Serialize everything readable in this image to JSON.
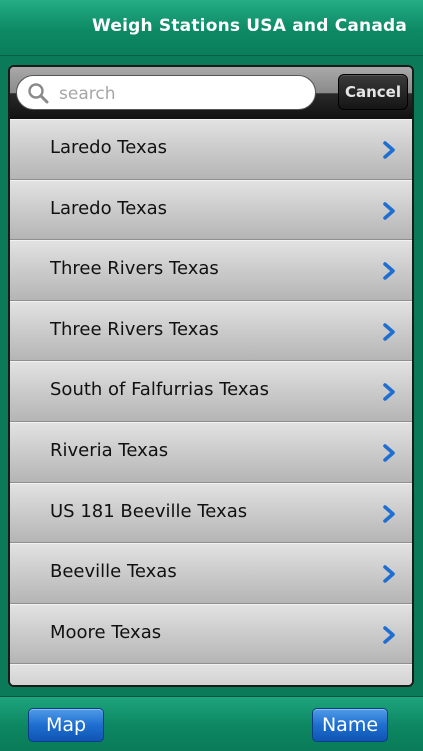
{
  "header": {
    "title": "Weigh Stations USA and Canada"
  },
  "search": {
    "placeholder": "search",
    "value": "",
    "cancel_label": "Cancel"
  },
  "list": {
    "items": [
      {
        "label": "Laredo Texas"
      },
      {
        "label": "Laredo Texas"
      },
      {
        "label": "Three Rivers Texas"
      },
      {
        "label": "Three Rivers Texas"
      },
      {
        "label": "South of Falfurrias Texas"
      },
      {
        "label": "Riveria Texas"
      },
      {
        "label": "US 181 Beeville Texas"
      },
      {
        "label": "Beeville Texas"
      },
      {
        "label": "Moore Texas"
      },
      {
        "label": ""
      }
    ]
  },
  "footer": {
    "map_label": "Map",
    "name_label": "Name"
  },
  "colors": {
    "header": "#0c8a64",
    "accent_blue": "#1f6fd0",
    "chevron": "#1e6fd1"
  }
}
